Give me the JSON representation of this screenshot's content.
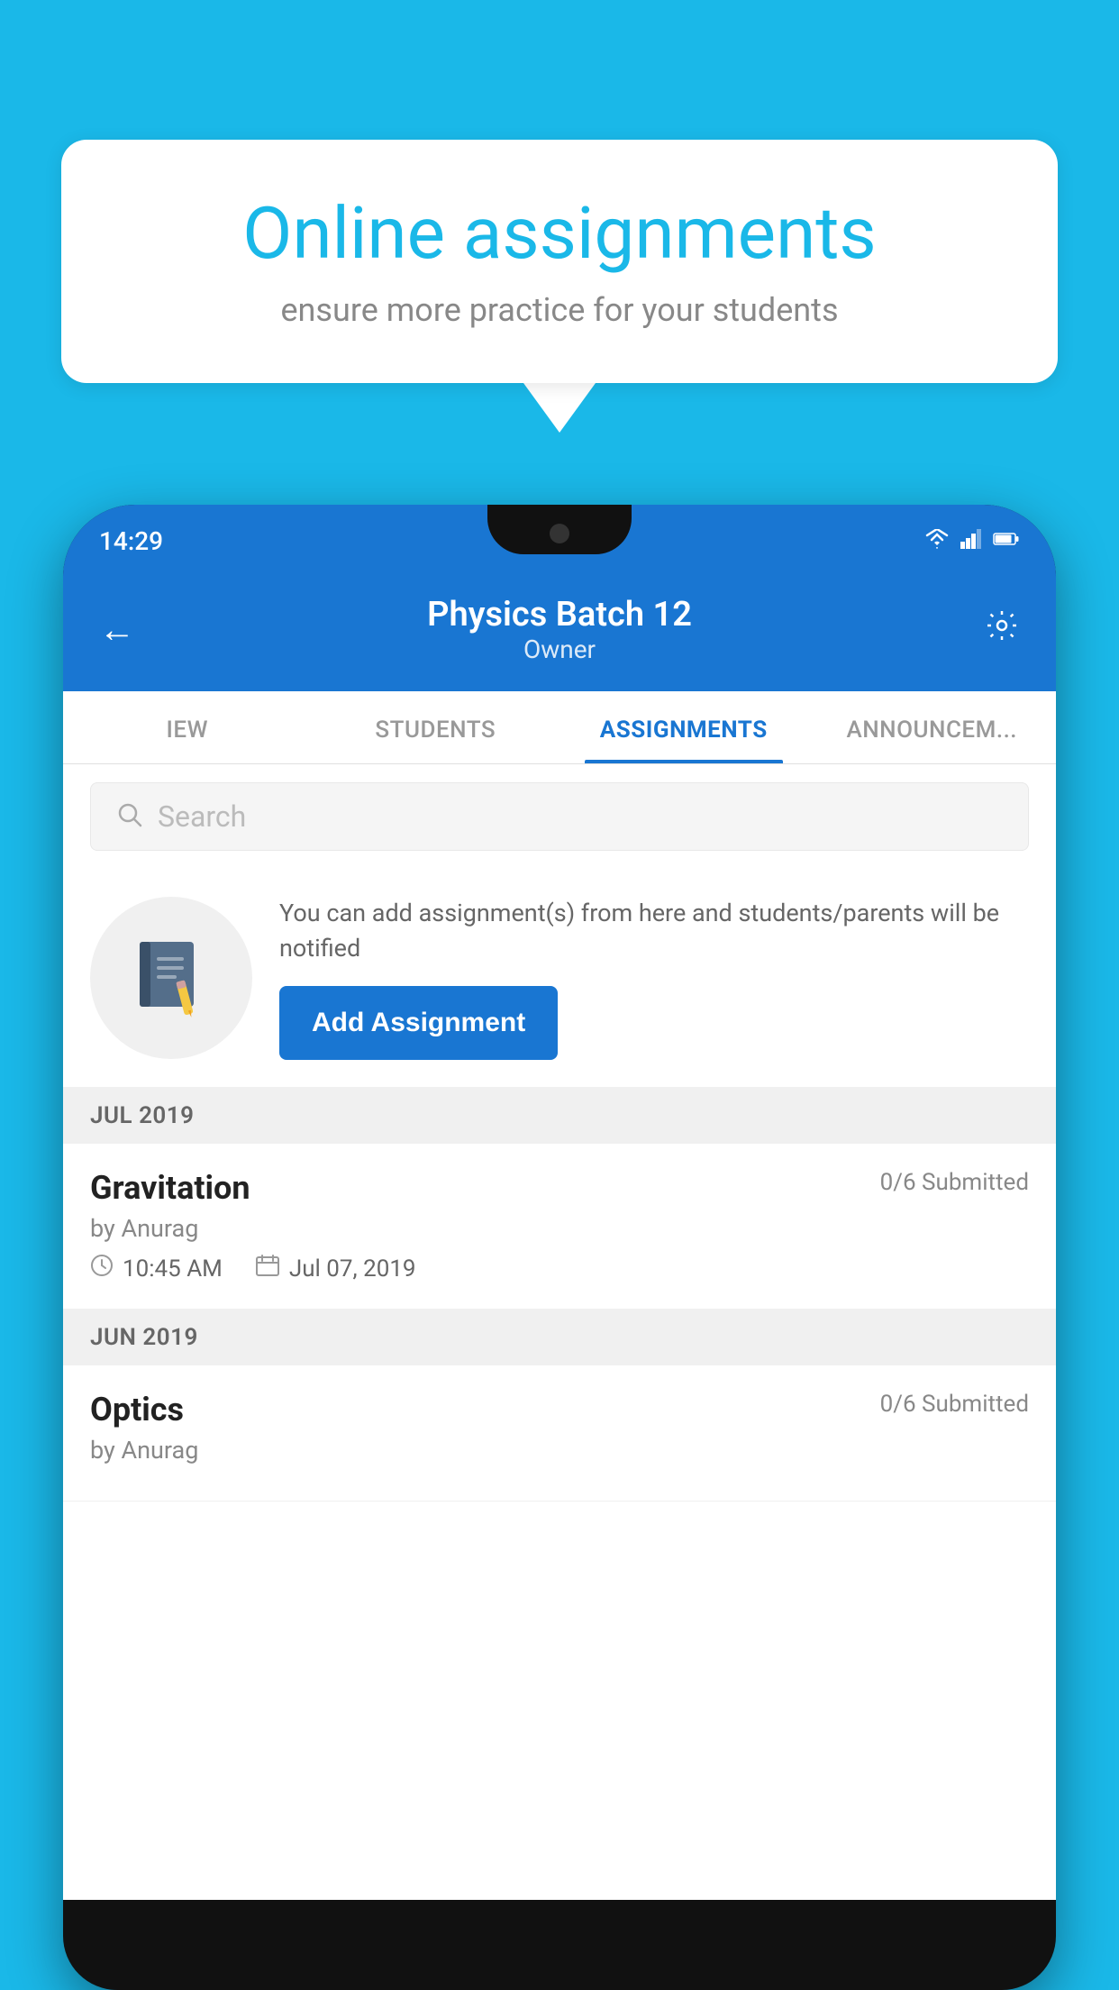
{
  "background_color": "#1ab8e8",
  "speech_bubble": {
    "title": "Online assignments",
    "subtitle": "ensure more practice for your students"
  },
  "status_bar": {
    "time": "14:29",
    "wifi_icon": "▾",
    "signal_icon": "▲",
    "battery_icon": "▮"
  },
  "app_header": {
    "title": "Physics Batch 12",
    "subtitle": "Owner",
    "back_label": "←",
    "settings_label": "⚙"
  },
  "tabs": [
    {
      "label": "IEW",
      "active": false
    },
    {
      "label": "STUDENTS",
      "active": false
    },
    {
      "label": "ASSIGNMENTS",
      "active": true
    },
    {
      "label": "ANNOUNCEM...",
      "active": false
    }
  ],
  "search": {
    "placeholder": "Search"
  },
  "promo": {
    "description": "You can add assignment(s) from here and students/parents will be notified",
    "button_label": "Add Assignment"
  },
  "sections": [
    {
      "header": "JUL 2019",
      "assignments": [
        {
          "name": "Gravitation",
          "submitted": "0/6 Submitted",
          "author": "by Anurag",
          "time": "10:45 AM",
          "date": "Jul 07, 2019"
        }
      ]
    },
    {
      "header": "JUN 2019",
      "assignments": [
        {
          "name": "Optics",
          "submitted": "0/6 Submitted",
          "author": "by Anurag",
          "time": "",
          "date": ""
        }
      ]
    }
  ]
}
